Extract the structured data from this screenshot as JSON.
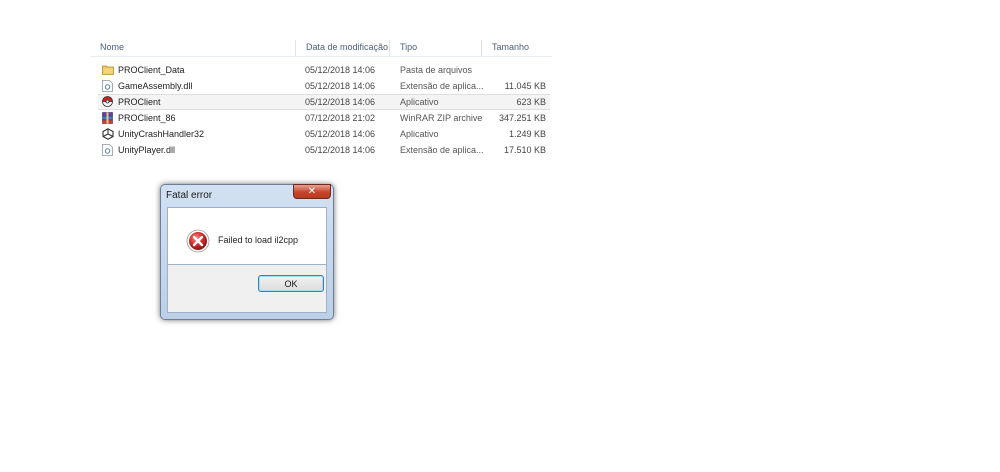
{
  "explorer": {
    "columns": {
      "name": "Nome",
      "date": "Data de modificação",
      "type": "Tipo",
      "size": "Tamanho"
    },
    "files": [
      {
        "name": "PROClient_Data",
        "date": "05/12/2018 14:06",
        "type": "Pasta de arquivos",
        "size": "",
        "icon": "folder-icon"
      },
      {
        "name": "GameAssembly.dll",
        "date": "05/12/2018 14:06",
        "type": "Extensão de aplica...",
        "size": "11.045 KB",
        "icon": "dll-file-icon"
      },
      {
        "name": "PROClient",
        "date": "05/12/2018 14:06",
        "type": "Aplicativo",
        "size": "623 KB",
        "icon": "pokeball-icon"
      },
      {
        "name": "PROClient_86",
        "date": "07/12/2018 21:02",
        "type": "WinRAR ZIP archive",
        "size": "347.251 KB",
        "icon": "winrar-archive-icon"
      },
      {
        "name": "UnityCrashHandler32",
        "date": "05/12/2018 14:06",
        "type": "Aplicativo",
        "size": "1.249 KB",
        "icon": "unity-icon"
      },
      {
        "name": "UnityPlayer.dll",
        "date": "05/12/2018 14:06",
        "type": "Extensão de aplica...",
        "size": "17.510 KB",
        "icon": "dll-file-icon"
      }
    ]
  },
  "dialog": {
    "title": "Fatal error",
    "close_label": "✕",
    "message": "Failed to load il2cpp",
    "ok_label": "OK",
    "icon": "error-icon"
  },
  "colors": {
    "error_red": "#d32f2f",
    "selection_bg": "#f4f4f4",
    "dialog_frame": "#c5d6eb"
  }
}
